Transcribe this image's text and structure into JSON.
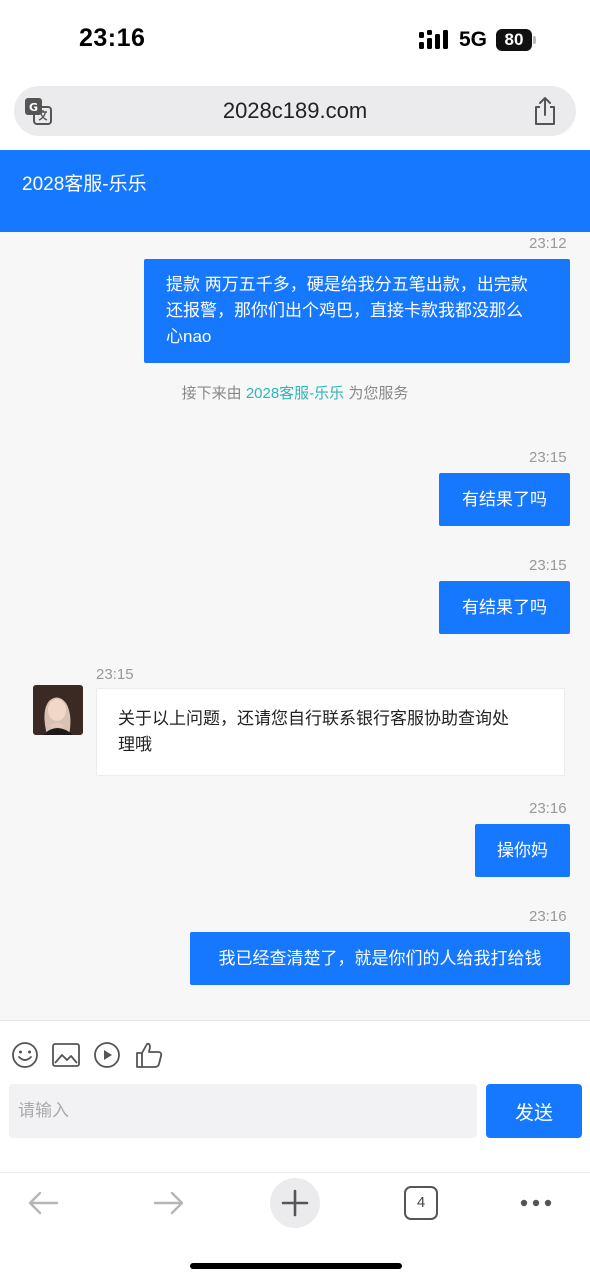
{
  "status_bar": {
    "time": "23:16",
    "network": "5G",
    "battery": "80"
  },
  "url_bar": {
    "url": "2028c189.com"
  },
  "chat_header": {
    "title": "2028客服-乐乐"
  },
  "messages": [
    {
      "time": "23:12",
      "text_lines": [
        "提款 两万五千多，硬是给我分五笔出款，出完款",
        "还报警，那你们出个鸡巴，直接卡款我都没那么",
        "心nao"
      ]
    },
    {
      "time": "23:15",
      "text": "有结果了吗"
    },
    {
      "time": "23:15",
      "text": "有结果了吗"
    },
    {
      "time": "23:15",
      "text_lines": [
        "关于以上问题，还请您自行联系银行客服协助查询处",
        "理哦"
      ]
    },
    {
      "time": "23:16",
      "text": "操你妈"
    },
    {
      "time": "23:16",
      "text": "我已经查清楚了，就是你们的人给我打给钱"
    }
  ],
  "system_notice": {
    "prefix": "接下来由",
    "agent": "2028客服-乐乐",
    "suffix": "为您服务"
  },
  "composer": {
    "placeholder": "请输入",
    "value": "",
    "send_label": "发送"
  },
  "browser_bar": {
    "tab_count": "4"
  },
  "colors": {
    "accent": "#1677ff",
    "agent_link": "#2ab7b7"
  }
}
